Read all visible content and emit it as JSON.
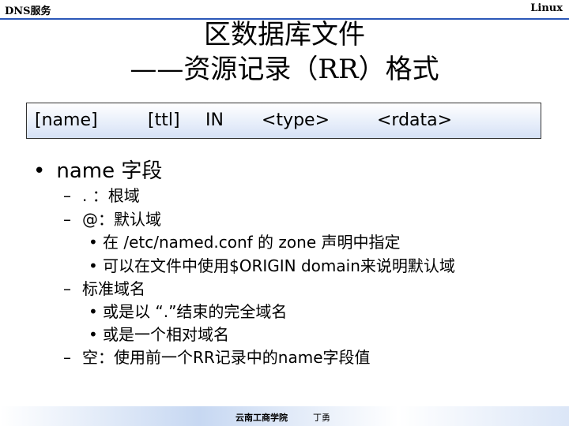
{
  "header": {
    "left": "DNS服务",
    "right": "Linux"
  },
  "title": {
    "line1": "区数据库文件",
    "line2": "——资源记录（RR）格式"
  },
  "format_box": {
    "name": "[name]",
    "ttl": "[ttl]",
    "class": "IN",
    "type": "<type>",
    "rdata": "<rdata>"
  },
  "main": {
    "bullet": "•",
    "heading": "name 字段",
    "items": [
      {
        "marker": "–",
        "text": ". ：根域"
      },
      {
        "marker": "–",
        "text": "@：默认域"
      },
      {
        "marker": "•",
        "text": "在 /etc/named.conf 的 zone 声明中指定"
      },
      {
        "marker": "•",
        "text": "可以在文件中使用$ORIGIN domain来说明默认域"
      },
      {
        "marker": "–",
        "text": "标准域名"
      },
      {
        "marker": "•",
        "text": "或是以 “.”结束的完全域名"
      },
      {
        "marker": "•",
        "text": "或是一个相对域名"
      },
      {
        "marker": "–",
        "text": "空：使用前一个RR记录中的name字段值"
      }
    ]
  },
  "footer": {
    "school": "云南工商学院",
    "author": "丁勇"
  }
}
